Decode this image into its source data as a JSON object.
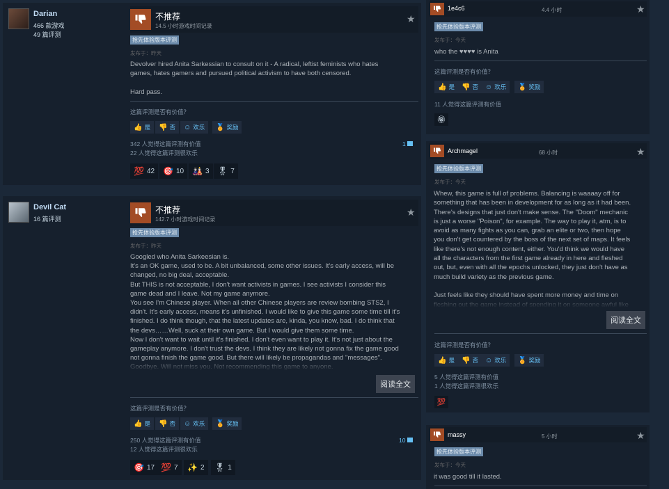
{
  "common": {
    "not_recommended": "不推荐",
    "early_access": "抢先体验版本评测",
    "helpful_question": "这篇评测是否有价值？",
    "vote_yes": "是",
    "vote_no": "否",
    "vote_funny": "欢乐",
    "vote_award": "奖励",
    "read_more": "阅读全文",
    "icons": {
      "thumb_down": "thumb-down-icon",
      "thumb_up": "thumb-up-icon",
      "star": "star-icon",
      "smile": "smile-icon",
      "award": "award-icon",
      "comment": "comment-icon"
    },
    "colors": {
      "background": "#1b2838",
      "card": "#16202d",
      "thumb_down": "#a34c25",
      "link": "#66c0f4",
      "tag": "#6b8aaa"
    }
  },
  "reviews": [
    {
      "username": "Darian",
      "games_owned": "466 款游戏",
      "reviews_count": "49 篇评测",
      "hours": "14.5 小时游戏时间记录",
      "posted": "发布于：昨天",
      "body": "Devolver hired Anita Sarkessian to consult on it - A radical, leftist feminists who hates\ngames, hates gamers and pursued political activism to have both censored.\n\nHard pass.",
      "helpful_count": "342 人觉得这篇评测有价值",
      "funny_count": "22 人觉得这篇评测很欢乐",
      "comments": "1",
      "awards": [
        {
          "icon": "💯",
          "count": "42"
        },
        {
          "icon": "🎯",
          "count": "10"
        },
        {
          "icon": "🎎",
          "count": "3"
        },
        {
          "icon": "🎖",
          "count": "7"
        }
      ]
    },
    {
      "username": "Devil Cat",
      "reviews_count": "16 篇评测",
      "hours": "142.7 小时游戏时间记录",
      "posted": "发布于：昨天",
      "body": "Googled who Anita Sarkeesian is.\nIt's an OK game, used to be. A bit unbalanced, some other issues. It's early access, will be\nchanged, no big deal, acceptable.\nBut THIS is not acceptable, I don't want activists in games. I see activists I consider this\ngame dead and I leave. Not my game anymore.\nYou see I'm Chinese player. When all other Chinese players are review bombing STS2, I\ndidn't. It's early access, means it's unfinished. I would like to give this game some time till it's\nfinished. I do think though, that the latest updates are, kinda, you know, bad. I do think that\nthe devs……Well, suck at their own game. But I would give them some time.\nNow I don't want to wait until it's finished. I don't even want to play it. It's not just about the\ngameplay anymore. I don't trust the devs. I think they are likely not gonna fix the game good\nnot gonna finish the game good. But there will likely be propagandas and \"messages\".\nGoodbye. Will not miss you. Not recommending this game to anyone.",
      "helpful_count": "250 人觉得这篇评测有价值",
      "funny_count": "12 人觉得这篇评测很欢乐",
      "comments": "10",
      "awards": [
        {
          "icon": "🎯",
          "count": "17"
        },
        {
          "icon": "💯",
          "count": "7"
        },
        {
          "icon": "✨",
          "count": "2"
        },
        {
          "icon": "🎖",
          "count": "1"
        }
      ]
    }
  ],
  "side_reviews": [
    {
      "username": "1e4c6",
      "hours": "4.4 小时",
      "posted": "发布于：今天",
      "body": "who the ♥♥♥♥ is Anita",
      "helpful_count": "11 人觉得这篇评测有价值",
      "awards": [
        {
          "icon": "🏵"
        }
      ]
    },
    {
      "username": "Archmagel",
      "hours": "68 小时",
      "posted": "发布于：今天",
      "body": "Whew, this game is full of problems. Balancing is waaaay off for\nsomething that has been in development for as long as it had been.\nThere's designs that just don't make sense. The \"Doom\" mechanic\nis just a worse \"Poison\", for example. The way to play it, atm, is to\navoid as many fights as you can, grab an elite or two, then hope\nyou don't get countered by the boss of the next set of maps. It feels\nlike there's not enough content, either. You'd think we would have\nall the characters from the first game already in here and fleshed\nout, but, even with all the epochs unlocked, they just don't have as\nmuch build variety as the previous game.\n\nJust feels like they should have spent more money and time on\nfleshing out the game instead of spending it on someone awful like",
      "helpful_count": "5 人觉得这篇评测有价值",
      "funny_count": "1 人觉得这篇评测很欢乐",
      "awards": [
        {
          "icon": "💯"
        }
      ]
    },
    {
      "username": "massy",
      "hours": "5 小时",
      "posted": "发布于：今天",
      "body": "it was good till it lasted."
    }
  ]
}
